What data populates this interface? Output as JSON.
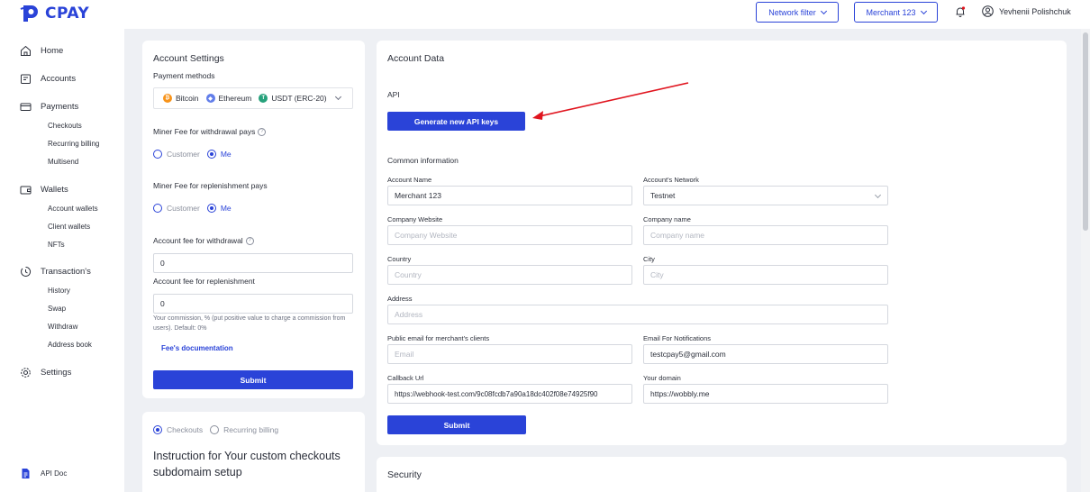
{
  "header": {
    "logo_text": "CPAY",
    "network_filter": "Network filter",
    "merchant_select": "Merchant 123",
    "user_name": "Yevhenii Polishchuk"
  },
  "sidebar": {
    "home": "Home",
    "accounts": "Accounts",
    "payments": "Payments",
    "checkouts": "Checkouts",
    "recurring_billing": "Recurring billing",
    "multisend": "Multisend",
    "wallets": "Wallets",
    "account_wallets": "Account wallets",
    "client_wallets": "Client wallets",
    "nfts": "NFTs",
    "transactions": "Transaction's",
    "history": "History",
    "swap": "Swap",
    "withdraw": "Withdraw",
    "address_book": "Address book",
    "settings": "Settings",
    "api_doc": "API Doc"
  },
  "account_settings": {
    "title": "Account Settings",
    "payment_methods_label": "Payment methods",
    "methods": [
      "Bitcoin",
      "Ethereum",
      "USDT (ERC-20)"
    ],
    "miner_fee_withdrawal_label": "Miner Fee for withdrawal pays",
    "miner_fee_replenishment_label": "Miner Fee for replenishment pays",
    "option_customer": "Customer",
    "option_me": "Me",
    "account_fee_withdrawal_label": "Account fee for withdrawal",
    "account_fee_withdrawal_value": "0",
    "account_fee_replenishment_label": "Account fee for replenishment",
    "account_fee_replenishment_value": "0",
    "commission_note": "Your commission, % (put positive value to charge a commission from users). Default: 0%",
    "fee_docs_link": "Fee's documentation",
    "submit": "Submit"
  },
  "checkout_setup": {
    "option_checkouts": "Checkouts",
    "option_recurring": "Recurring billing",
    "title": "Instruction for Your custom checkouts subdomaim setup"
  },
  "account_data": {
    "title": "Account Data",
    "api_label": "API",
    "generate_keys": "Generate new API keys",
    "common_info": "Common information",
    "account_name_label": "Account Name",
    "account_name_value": "Merchant 123",
    "network_label": "Account's Network",
    "network_value": "Testnet",
    "company_website_label": "Company Website",
    "company_website_placeholder": "Company Website",
    "company_name_label": "Company name",
    "company_name_placeholder": "Company name",
    "country_label": "Country",
    "country_placeholder": "Country",
    "city_label": "City",
    "city_placeholder": "City",
    "address_label": "Address",
    "address_placeholder": "Address",
    "public_email_label": "Public email for merchant's clients",
    "public_email_placeholder": "Email",
    "notify_email_label": "Email For Notifications",
    "notify_email_value": "testcpay5@gmail.com",
    "callback_label": "Callback Url",
    "callback_value": "https://webhook-test.com/9c08fcdb7a90a18dc402f08e74925f90",
    "domain_label": "Your domain",
    "domain_value": "https://wobbly.me",
    "submit": "Submit"
  },
  "security": {
    "title": "Security"
  },
  "colors": {
    "accent": "#2a43d8",
    "arrow": "#e0141e"
  }
}
